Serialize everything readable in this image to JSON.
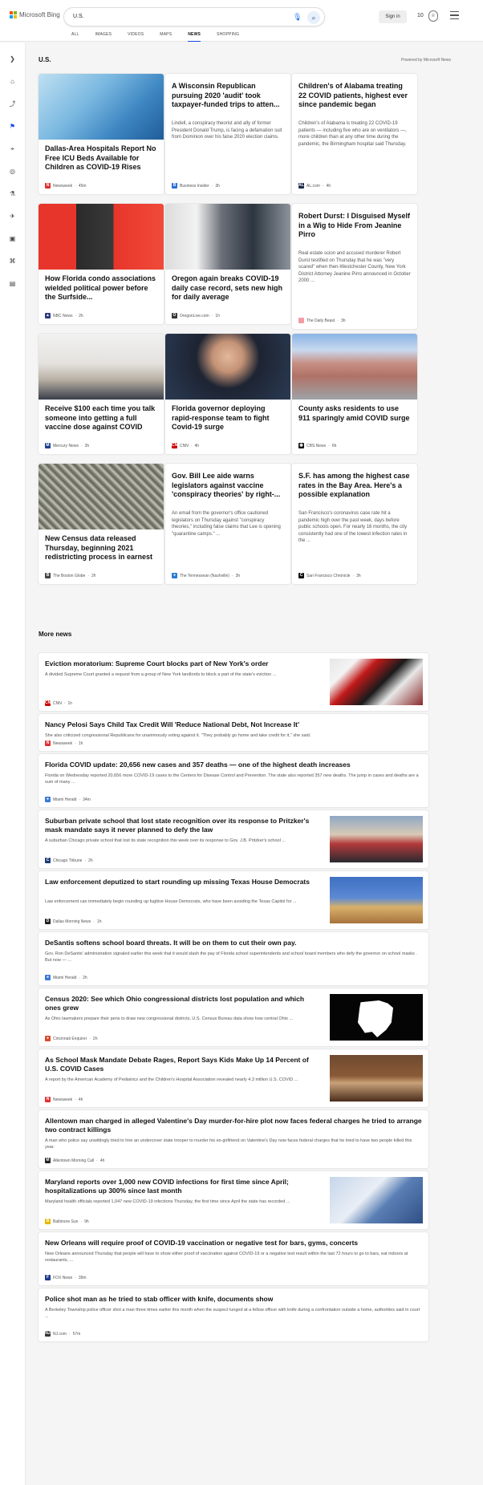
{
  "header": {
    "brand": "Microsoft Bing",
    "query": "U.S.",
    "sign_in": "Sign in",
    "rewards_points": "10",
    "tabs": [
      "ALL",
      "IMAGES",
      "VIDEOS",
      "MAPS",
      "NEWS",
      "SHOPPING"
    ],
    "active_tab": "NEWS"
  },
  "rail": {
    "icons": [
      "expand-icon",
      "home-icon",
      "trending-icon",
      "flag-icon",
      "location-icon",
      "world-icon",
      "science-icon",
      "sports-icon",
      "entertainment-icon",
      "politics-icon",
      "business-icon"
    ]
  },
  "section": {
    "title": "U.S.",
    "powered": "Powered by Microsoft News"
  },
  "cards": [
    {
      "title": "Dallas-Area Hospitals Report No Free ICU Beds Available for Children as COVID-19 Rises",
      "desc": "",
      "source": "Newsweek",
      "time": "45m",
      "icon": "N",
      "icon_color": "#e03030",
      "has_image": true
    },
    {
      "title": "A Wisconsin Republican pursuing 2020 'audit' took taxpayer-funded trips to atten...",
      "desc": "Lindell, a conspiracy theorist and ally of former President Donald Trump, is facing a defamation suit from Dominion over his false 2020 election claims.",
      "source": "Business Insider",
      "time": "3h",
      "icon": "B",
      "icon_color": "#2b6fd6",
      "has_image": false
    },
    {
      "title": "Children's of Alabama treating 22 COVID patients, highest ever since pandemic began",
      "desc": "Children's of Alabama is treating 22 COVID-19 patients — including five who are on ventilators —, more children than at any other time during the pandemic, the Birmingham hospital said Thursday.",
      "source": "AL.com",
      "time": "4h",
      "icon": "AL",
      "icon_color": "#1b2a48",
      "has_image": false
    },
    {
      "title": "How Florida condo associations wielded political power before the Surfside...",
      "desc": "",
      "source": "NBC News",
      "time": "2h",
      "icon": "▲",
      "icon_color": "#2d3d7d",
      "has_image": true
    },
    {
      "title": "Oregon again breaks COVID-19 daily case record, sets new high for daily average",
      "desc": "",
      "source": "OregonLive.com",
      "time": "1h",
      "icon": "O",
      "icon_color": "#333333",
      "has_image": true
    },
    {
      "title": "Robert Durst: I Disguised Myself in a Wig to Hide From Jeanine Pirro",
      "desc": "Real estate scion and accused murderer Robert Durst testified on Thursday that he was \"very scared\" when then-Westchester County, New York District Attorney Jeanine Pirro announced in October 2000 ...",
      "source": "The Daily Beast",
      "time": "3h",
      "icon": "",
      "icon_color": "#f29ca4",
      "has_image": false
    },
    {
      "title": "Receive $100 each time you talk someone into getting a full vaccine dose against COVID",
      "desc": "",
      "source": "Mercury News",
      "time": "3h",
      "icon": "M",
      "icon_color": "#1d3f8a",
      "has_image": true
    },
    {
      "title": "Florida governor deploying rapid-response team to fight Covid-19 surge",
      "desc": "",
      "source": "CNN",
      "time": "4h",
      "icon": "CNN",
      "icon_color": "#cc0000",
      "has_image": true
    },
    {
      "title": "County asks residents to use 911 sparingly amid COVID surge",
      "desc": "",
      "source": "CBS News",
      "time": "6h",
      "icon": "◉",
      "icon_color": "#111111",
      "has_image": true
    },
    {
      "title": "New Census data released Thursday, beginning 2021 redistricting process in earnest",
      "desc": "",
      "source": "The Boston Globe",
      "time": "2h",
      "icon": "B",
      "icon_color": "#444444",
      "has_image": true
    },
    {
      "title": "Gov. Bill Lee aide warns legislators against vaccine 'conspiracy theories' by right-...",
      "desc": "An email from the governor's office cautioned legislators on Thursday against \"conspiracy theories,\" including false claims that Lee is opening \"quarantine camps.\" ...",
      "source": "The Tennessean (Nashville)",
      "time": "3h",
      "icon": "●",
      "icon_color": "#2a7bd5",
      "has_image": false
    },
    {
      "title": "S.F. has among the highest case rates in the Bay Area. Here's a possible explanation",
      "desc": "San Francisco's coronavirus case rate hit a pandemic high over the past week, days before public schools open. For nearly 16 months, the city consistently had one of the lowest infection rates in the ...",
      "source": "San Francisco Chronicle",
      "time": "3h",
      "icon": "C",
      "icon_color": "#111111",
      "has_image": false
    }
  ],
  "more": {
    "title": "More news",
    "items": [
      {
        "title": "Eviction moratorium: Supreme Court blocks part of New York's order",
        "desc": "A divided Supreme Court granted a request from a group of New York landlords to block a part of the state's eviction ...",
        "source": "CNN",
        "time": "1h",
        "icon": "CNN",
        "icon_color": "#cc0000",
        "image": "protest"
      },
      {
        "title": "Nancy Pelosi Says Child Tax Credit Will 'Reduce National Debt, Not Increase It'",
        "desc": "She also criticized congressional Republicans for unanimously voting against it. \"They probably go home and take credit for it,\" she said.",
        "source": "Newsweek",
        "time": "1h",
        "icon": "N",
        "icon_color": "#e03030",
        "image": ""
      },
      {
        "title": "Florida COVID update: 20,656 new cases and 357 deaths — one of the highest death increases",
        "desc": "Florida on Wednesday reported 20,656 more COVID-19 cases to the Centers for Disease Control and Prevention. The state also reported 357 new deaths. The jump in cases and deaths are a sum of many ...",
        "source": "Miami Herald",
        "time": "34m",
        "icon": "●",
        "icon_color": "#3b7bd5",
        "image": ""
      },
      {
        "title": "Suburban private school that lost state recognition over its response to Pritzker's mask mandate says it never planned to defy the law",
        "desc": "A suburban Chicago private school that lost its state recognition this week over its response to Gov. J.B. Pritzker's school ...",
        "source": "Chicago Tribune",
        "time": "2h",
        "icon": "C",
        "icon_color": "#1f3a75",
        "image": "school"
      },
      {
        "title": "Law enforcement deputized to start rounding up missing Texas House Democrats",
        "desc": "Law enforcement can immediately begin rounding up fugitive House Democrats, who have been avoiding the Texas Capitol for ...",
        "source": "Dallas Morning News",
        "time": "1h",
        "icon": "D",
        "icon_color": "#222222",
        "image": "texas"
      },
      {
        "title": "DeSantis softens school board threats. It will be on them to cut their own pay.",
        "desc": "Gov. Ron DeSantis' administration signaled earlier this week that it would slash the pay of Florida school superintendents and school board members who defy the governor on school masks . But now — ...",
        "source": "Miami Herald",
        "time": "2h",
        "icon": "●",
        "icon_color": "#3b7bd5",
        "image": ""
      },
      {
        "title": "Census 2020: See which Ohio congressional districts lost population and which ones grew",
        "desc": "As Ohio lawmakers prepare their pens to draw new congressional districts, U.S. Census Bureau data show how central Ohio ...",
        "source": "Cincinnati Enquirer",
        "time": "2h",
        "icon": "●",
        "icon_color": "#d64a2a",
        "image": "ohio"
      },
      {
        "title": "As School Mask Mandate Debate Rages, Report Says Kids Make Up 14 Percent of U.S. COVID Cases",
        "desc": "A report by the American Academy of Pediatrics and the Children's Hospital Association revealed nearly 4.3 million U.S. COVID ...",
        "source": "Newsweek",
        "time": "4h",
        "icon": "N",
        "icon_color": "#e03030",
        "image": "podium"
      },
      {
        "title": "Allentown man charged in alleged Valentine's Day murder-for-hire plot now faces federal charges he tried to arrange two contract killings",
        "desc": "A man who police say unwittingly tried to hire an undercover state trooper to murder his ex-girlfriend on Valentine's Day now faces federal charges that he tried to have two people killed this year.",
        "source": "Allentown Morning Call",
        "time": "4h",
        "icon": "M",
        "icon_color": "#222222",
        "image": ""
      },
      {
        "title": "Maryland reports over 1,000 new COVID infections for first time since April; hospitalizations up 300% since last month",
        "desc": "Maryland health officials reported 1,047 new COVID-19 infections Thursday, the first time since April the state has recorded ...",
        "source": "Baltimore Sun",
        "time": "9h",
        "icon": "B",
        "icon_color": "#e8b800",
        "image": "lab"
      },
      {
        "title": "New Orleans will require proof of COVID-19 vaccination or negative test for bars, gyms, concerts",
        "desc": "New Orleans announced Thursday that people will have to show either proof of vaccination against COVID-19 or a negative test result within the last 72 hours to go to bars, eat indoors at restaurants, ...",
        "source": "FOX News",
        "time": "39m",
        "icon": "F",
        "icon_color": "#1b3a8a",
        "image": ""
      },
      {
        "title": "Police shot man as he tried to stab officer with knife, documents show",
        "desc": "A Berkeley Township police officer shot a man three times earlier this month when the suspect lunged at a fellow officer with knife during a confrontation outside a home, authorities said in court ...",
        "source": "NJ.com",
        "time": "57m",
        "icon": "NJ",
        "icon_color": "#333333",
        "image": ""
      }
    ]
  },
  "colors": {
    "accent": "#174ae4",
    "background": "#f5f5f5",
    "card": "#ffffff"
  }
}
